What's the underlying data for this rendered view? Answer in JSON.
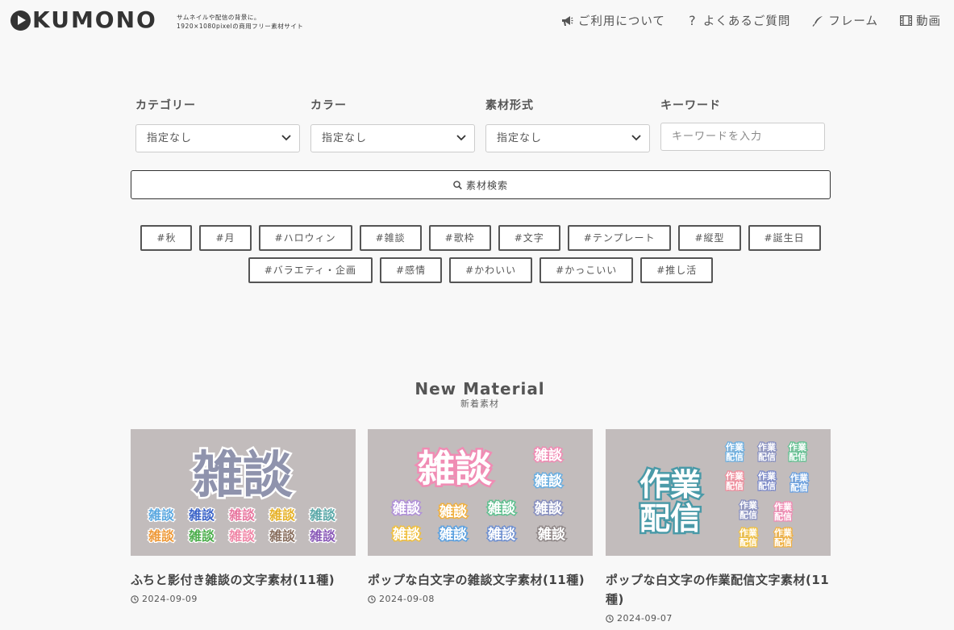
{
  "header": {
    "logo_letters": "KUMONO",
    "tagline_1": "サムネイルや配信の背景に。",
    "tagline_2": "1920×1080pixelの商用フリー素材サイト",
    "nav": [
      {
        "label": "ご利用について",
        "icon": "megaphone-icon"
      },
      {
        "label": "よくあるご質問",
        "icon": "question-icon"
      },
      {
        "label": "フレーム",
        "icon": "feather-icon"
      },
      {
        "label": "動画",
        "icon": "film-icon"
      }
    ]
  },
  "filters": {
    "category": {
      "label": "カテゴリー",
      "value": "指定なし"
    },
    "color": {
      "label": "カラー",
      "value": "指定なし"
    },
    "format": {
      "label": "素材形式",
      "value": "指定なし"
    },
    "keyword": {
      "label": "キーワード",
      "placeholder": "キーワードを入力"
    },
    "search_button": "素材検索"
  },
  "tags": {
    "row1": [
      "#秋",
      "#月",
      "#ハロウィン",
      "#雑談",
      "#歌枠",
      "#文字",
      "#テンプレート",
      "#縦型",
      "#誕生日"
    ],
    "row2": [
      "#バラエティ・企画",
      "#感情",
      "#かわいい",
      "#かっこいい",
      "#推し活"
    ]
  },
  "section": {
    "title_en": "New Material",
    "title_ja": "新着素材"
  },
  "cards": [
    {
      "title": "ふちと影付き雑談の文字素材(11種)",
      "date": "2024-09-09",
      "thumb_main": "雑談",
      "thumb_small": "雑談"
    },
    {
      "title": "ポップな白文字の雑談文字素材(11種)",
      "date": "2024-09-08",
      "thumb_main": "雑談",
      "thumb_small": "雑談"
    },
    {
      "title": "ポップな白文字の作業配信文字素材(11種)",
      "date": "2024-09-07",
      "thumb_main_1": "作業",
      "thumb_main_2": "配信",
      "thumb_small_1": "作業",
      "thumb_small_2": "配信"
    }
  ],
  "colors": {
    "background": "#f8f8f8",
    "thumb_bg": "#c2bcbc",
    "text": "#444444"
  }
}
